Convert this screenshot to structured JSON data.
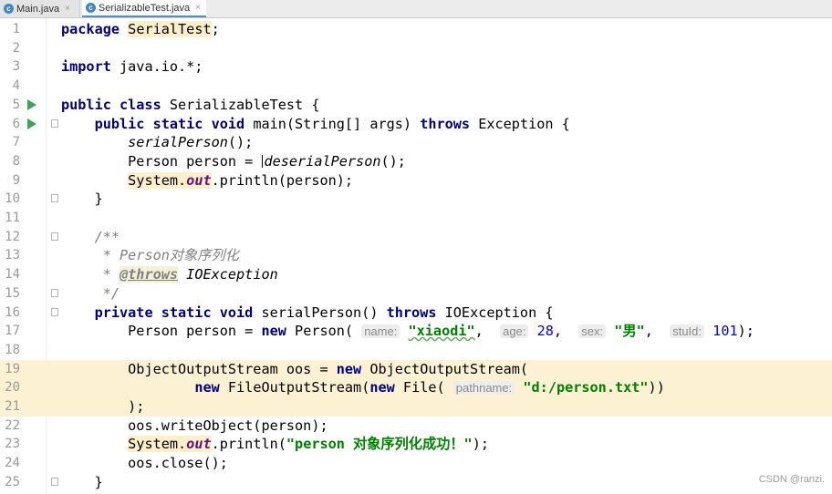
{
  "tabs": [
    {
      "label": "Main.java",
      "close": "×"
    },
    {
      "label": "SerializableTest.java",
      "close": "×"
    }
  ],
  "lines": {
    "n1": "1",
    "n2": "2",
    "n3": "3",
    "n4": "4",
    "n5": "5",
    "n6": "6",
    "n7": "7",
    "n8": "8",
    "n9": "9",
    "n10": "10",
    "n11": "11",
    "n12": "12",
    "n13": "13",
    "n14": "14",
    "n15": "15",
    "n16": "16",
    "n17": "17",
    "n18": "18",
    "n19": "19",
    "n20": "20",
    "n21": "21",
    "n22": "22",
    "n23": "23",
    "n24": "24",
    "n25": "25"
  },
  "code": {
    "l1_kw": "package",
    "l1_name": "SerialTest",
    "l1_end": ";",
    "l3_kw": "import",
    "l3_rest": " java.io.*;",
    "l5_kw": "public class",
    "l5_rest": " SerializableTest {",
    "l6_kw": "public static void",
    "l6_mid": " main(String[] args) ",
    "l6_kw2": "throws",
    "l6_end": " Exception {",
    "l7_call": "serialPerson",
    "l7_end": "();",
    "l8_start": "Person person = ",
    "l8_call": "deserialPerson",
    "l8_end": "();",
    "l9_sys": "System.",
    "l9_out": "out",
    "l9_end": ".println(person);",
    "l10": "}",
    "l12": "/**",
    "l13": " * Person对象序列化",
    "l14_star": " * ",
    "l14_tag": "@throws",
    "l14_rest": " IOException",
    "l15": " */",
    "l16_kw": "private static void",
    "l16_mid": " serialPerson() ",
    "l16_kw2": "throws",
    "l16_end": " IOException {",
    "l17_start": "Person person = ",
    "l17_new": "new",
    "l17_cls": " Person( ",
    "l17_h1": "name:",
    "l17_v1": "\"xiaodi\"",
    "l17_c1": ",  ",
    "l17_h2": "age:",
    "l17_v2": "28",
    "l17_c2": ",  ",
    "l17_h3": "sex:",
    "l17_v3": "\"男\"",
    "l17_c3": ",  ",
    "l17_h4": "stuId:",
    "l17_v4": "101",
    "l17_end": ");",
    "l19_start": "ObjectOutputStream oos = ",
    "l19_new": "new",
    "l19_end": " ObjectOutputStream(",
    "l20_new": "new",
    "l20_mid": " FileOutputStream(",
    "l20_new2": "new",
    "l20_mid2": " File( ",
    "l20_h": "pathname:",
    "l20_v": "\"d:/person.txt\"",
    "l20_end": "))",
    "l21": ");",
    "l22": "oos.writeObject(person);",
    "l23_sys": "System.",
    "l23_out": "out",
    "l23_mid": ".println(",
    "l23_str": "\"person 对象序列化成功！\"",
    "l23_end": ");",
    "l24": "oos.close();",
    "l25": "}"
  },
  "watermark": "CSDN @ranzi."
}
